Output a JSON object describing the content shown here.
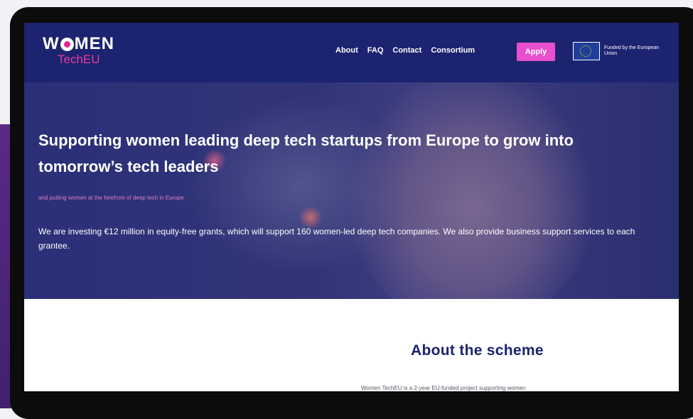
{
  "brand": {
    "logo_top": "W",
    "logo_top_rest": "MEN",
    "logo_sub": "TechEU"
  },
  "nav": {
    "links": [
      "About",
      "FAQ",
      "Contact",
      "Consortium"
    ],
    "apply_label": "Apply",
    "eu_badge_text": "Funded by the European Union"
  },
  "hero": {
    "title": "Supporting women leading deep tech startups from Europe to grow into tomorrow’s tech leaders",
    "tagline": "and putting women at the forefront of deep tech in Europe",
    "description": "We are investing €12 million in equity-free grants, which will support  160 women-led deep tech companies. We also provide business support services to each grantee."
  },
  "about": {
    "title": "About the scheme",
    "text": "Women TechEU is a 2-year EU-funded project supporting women"
  },
  "colors": {
    "nav_bg": "#1c2370",
    "accent_pink": "#e84fcf",
    "logo_pink": "#e53d9c",
    "heading_navy": "#1c2370"
  }
}
